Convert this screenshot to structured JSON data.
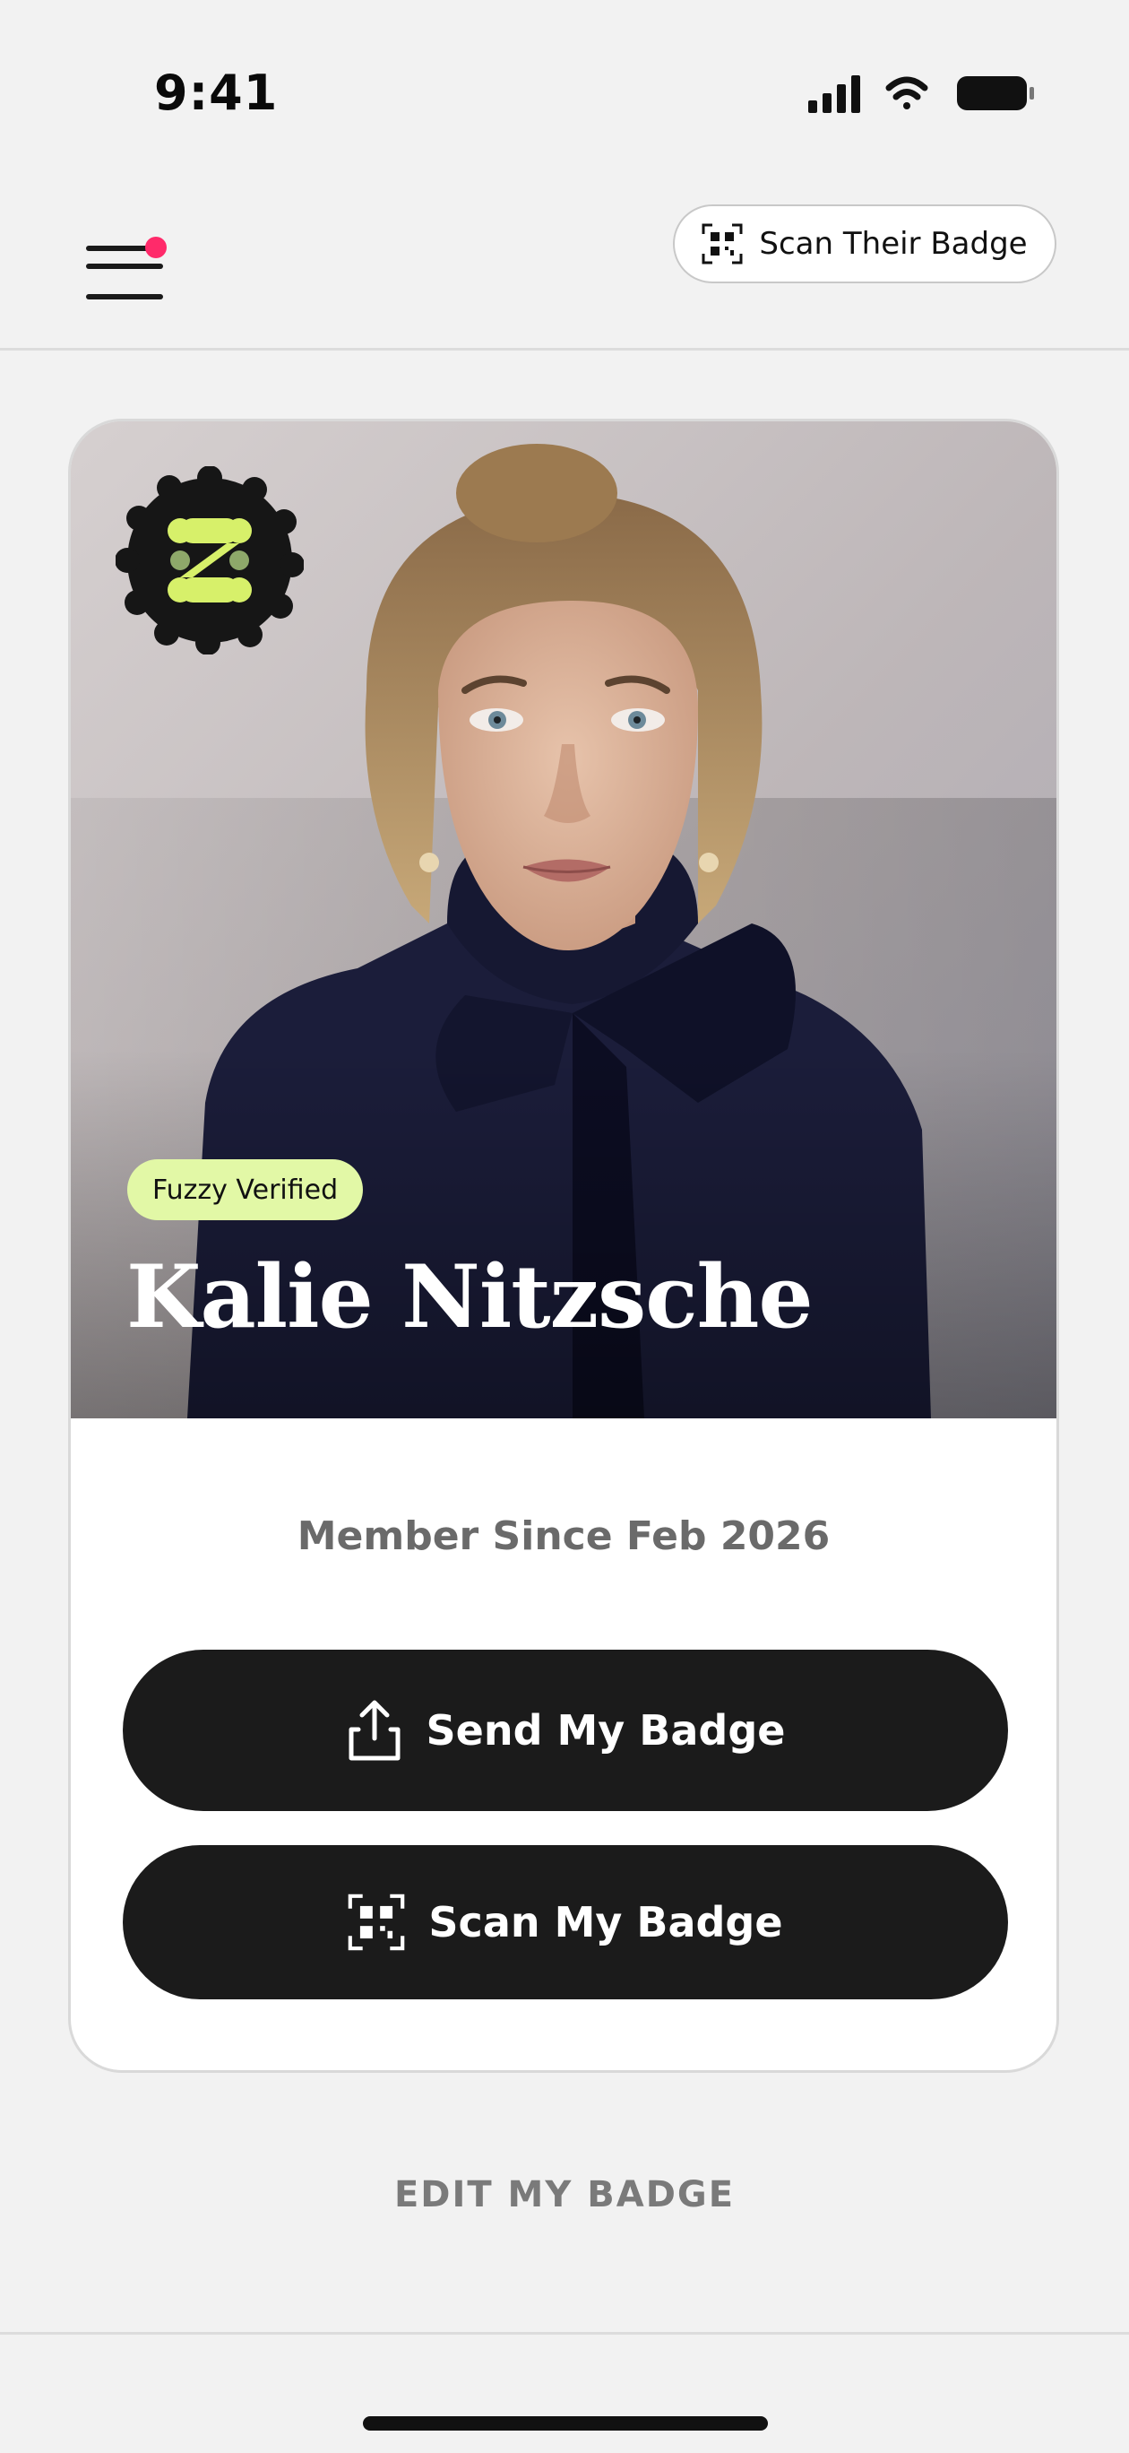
{
  "status_bar": {
    "time": "9:41",
    "icons": [
      "cellular-signal-icon",
      "wifi-icon",
      "battery-icon"
    ]
  },
  "header": {
    "menu_icon": "hamburger-menu-icon",
    "notification_color": "#ff2a6a",
    "scan_their_badge_label": "Scan Their Badge",
    "scan_their_badge_icon": "qr-scan-icon"
  },
  "badge_card": {
    "brand_icon": "brand-badge-icon",
    "verified_label": "Fuzzy Verified",
    "verified_color": "#e2f8a6",
    "name": "Kalie Nitzsche",
    "member_since": "Member Since Feb 2026",
    "send_button_label": "Send My Badge",
    "send_button_icon": "share-upload-icon",
    "scan_button_label": "Scan My Badge",
    "scan_button_icon": "qr-scan-icon"
  },
  "footer": {
    "edit_label": "EDIT MY BADGE"
  },
  "colors": {
    "background": "#f2f2f2",
    "button_dark": "#1b1b1b",
    "brand_lime": "#d7f06a"
  }
}
